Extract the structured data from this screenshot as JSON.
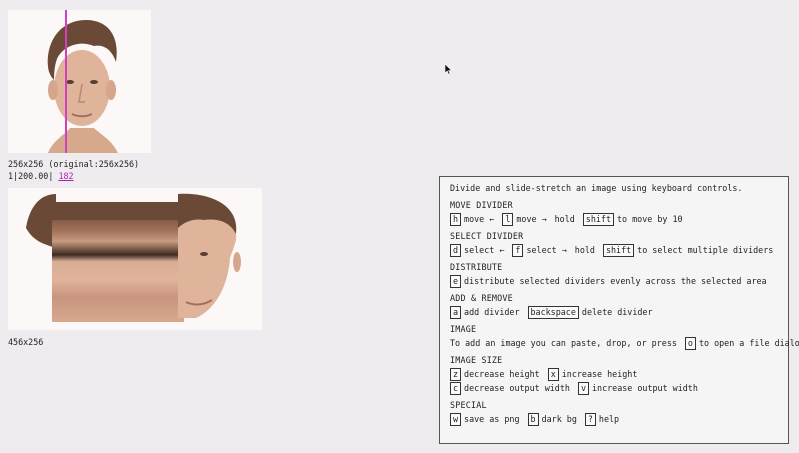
{
  "source": {
    "dimensions_label": "256x256 (original:256x256)",
    "divider_info": "1|200.00|",
    "divider_link": "182"
  },
  "output": {
    "dimensions_label": "456x256"
  },
  "help": {
    "intro": "Divide and slide-stretch an image using keyboard controls.",
    "sections": [
      {
        "title": "MOVE DIVIDER",
        "rows": [
          [
            {
              "k": "h"
            },
            {
              "t": "move ←"
            },
            {
              "k": "l"
            },
            {
              "t": "move →"
            },
            {
              "t": "hold"
            },
            {
              "k": "shift"
            },
            {
              "t": "to move by 10"
            }
          ]
        ]
      },
      {
        "title": "SELECT DIVIDER",
        "rows": [
          [
            {
              "k": "d"
            },
            {
              "t": "select ←"
            },
            {
              "k": "f"
            },
            {
              "t": "select →"
            },
            {
              "t": "hold"
            },
            {
              "k": "shift"
            },
            {
              "t": "to select multiple dividers"
            }
          ]
        ]
      },
      {
        "title": "DISTRIBUTE",
        "rows": [
          [
            {
              "k": "e"
            },
            {
              "t": "distribute selected dividers evenly across the selected area"
            }
          ]
        ]
      },
      {
        "title": "ADD & REMOVE",
        "rows": [
          [
            {
              "k": "a"
            },
            {
              "t": "add divider"
            },
            {
              "k": "backspace"
            },
            {
              "t": "delete divider"
            }
          ]
        ]
      },
      {
        "title": "IMAGE",
        "rows": [
          [
            {
              "t": "To add an image you can paste, drop, or press"
            },
            {
              "k": "o"
            },
            {
              "t": "to open a file dialog."
            }
          ]
        ]
      },
      {
        "title": "IMAGE SIZE",
        "rows": [
          [
            {
              "k": "z"
            },
            {
              "t": "decrease height"
            },
            {
              "k": "x"
            },
            {
              "t": "increase height"
            }
          ],
          [
            {
              "k": "c"
            },
            {
              "t": "decrease output width"
            },
            {
              "k": "v"
            },
            {
              "t": "increase output width"
            }
          ]
        ]
      },
      {
        "title": "SPECIAL",
        "rows": [
          [
            {
              "k": "w"
            },
            {
              "t": "save as png"
            },
            {
              "k": "b"
            },
            {
              "t": "dark bg"
            },
            {
              "k": "?"
            },
            {
              "t": "help"
            }
          ]
        ]
      }
    ]
  },
  "colors": {
    "background": "#eeecee",
    "divider": "#d040c0",
    "link": "#b020b0"
  }
}
